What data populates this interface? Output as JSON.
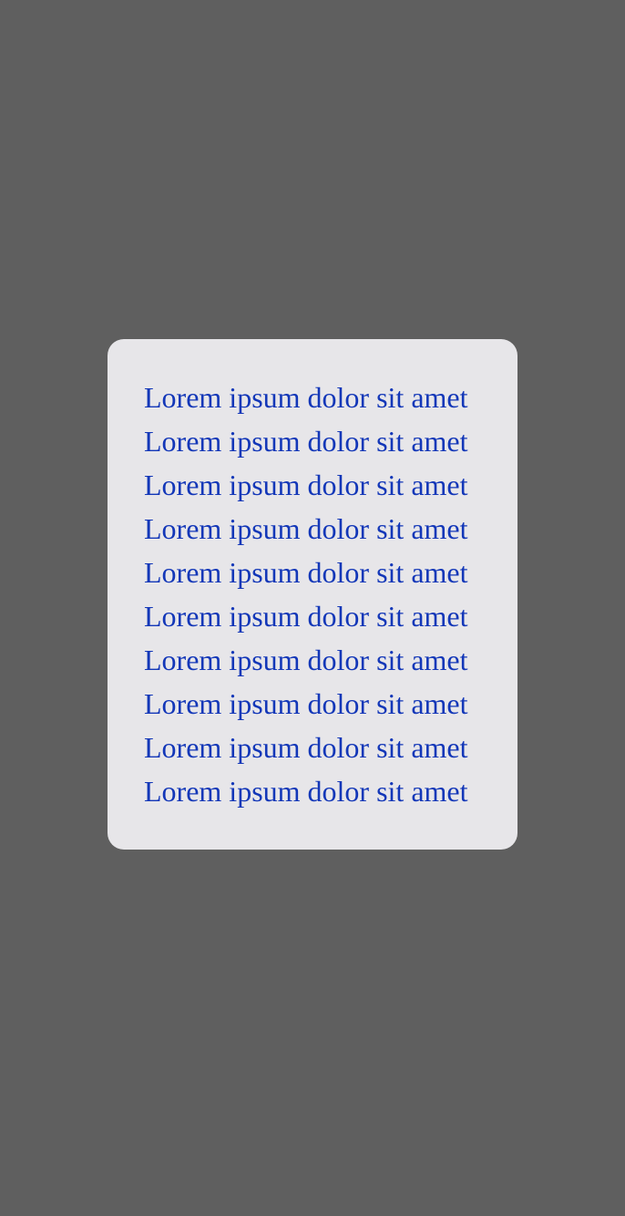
{
  "colors": {
    "background": "#5f5f5f",
    "card": "#e7e6e9",
    "text": "#1337b8"
  },
  "card": {
    "lines": [
      "Lorem ipsum dolor sit amet",
      "Lorem ipsum dolor sit amet",
      "Lorem ipsum dolor sit amet",
      "Lorem ipsum dolor sit amet",
      "Lorem ipsum dolor sit amet",
      "Lorem ipsum dolor sit amet",
      "Lorem ipsum dolor sit amet",
      "Lorem ipsum dolor sit amet",
      "Lorem ipsum dolor sit amet",
      "Lorem ipsum dolor sit amet"
    ]
  }
}
